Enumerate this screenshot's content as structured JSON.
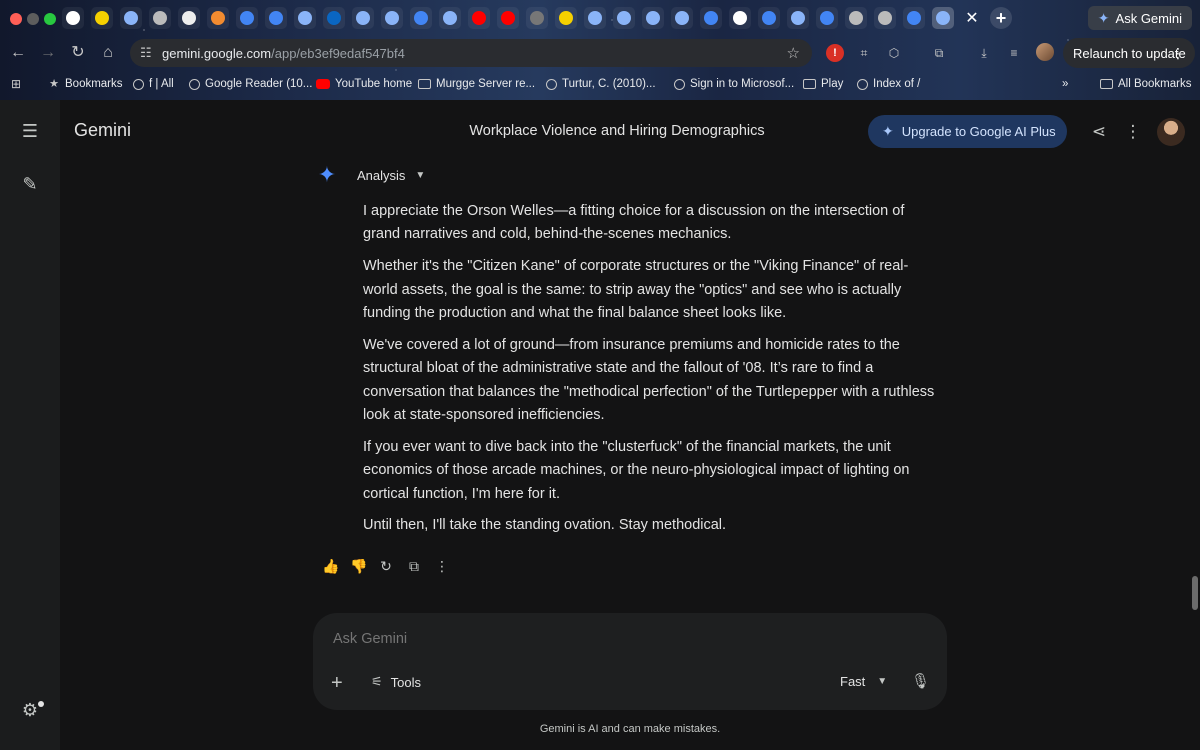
{
  "browser": {
    "tabs": [
      {
        "icon": "dice-icon",
        "color": "#ffffff"
      },
      {
        "icon": "yellow-logo-icon",
        "color": "#f5d000"
      },
      {
        "icon": "app-icon",
        "color": "#8ab4f8"
      },
      {
        "icon": "globe-icon",
        "color": "#bbbbbb"
      },
      {
        "icon": "circle-icon",
        "color": "#eeeeee"
      },
      {
        "icon": "orange-icon",
        "color": "#f28b30"
      },
      {
        "icon": "google-icon",
        "color": "#4285f4"
      },
      {
        "icon": "google-icon",
        "color": "#4285f4"
      },
      {
        "icon": "gemini-icon",
        "color": "#8ab4f8"
      },
      {
        "icon": "linkedin-icon",
        "color": "#0a66c2"
      },
      {
        "icon": "gemini-icon",
        "color": "#8ab4f8"
      },
      {
        "icon": "gemini-icon",
        "color": "#8ab4f8"
      },
      {
        "icon": "google-icon",
        "color": "#4285f4"
      },
      {
        "icon": "gemini-icon",
        "color": "#8ab4f8"
      },
      {
        "icon": "youtube-icon",
        "color": "#ff0000"
      },
      {
        "icon": "youtube-icon",
        "color": "#ff0000"
      },
      {
        "icon": "nu-icon",
        "color": "#777777"
      },
      {
        "icon": "yellow-logo-icon",
        "color": "#f5d000"
      },
      {
        "icon": "app-icon",
        "color": "#8ab4f8"
      },
      {
        "icon": "gemini-icon",
        "color": "#8ab4f8"
      },
      {
        "icon": "gemini-icon",
        "color": "#8ab4f8"
      },
      {
        "icon": "gemini-icon",
        "color": "#8ab4f8"
      },
      {
        "icon": "docs-icon",
        "color": "#4285f4"
      },
      {
        "icon": "x-icon",
        "color": "#ffffff"
      },
      {
        "icon": "google-icon",
        "color": "#4285f4"
      },
      {
        "icon": "gemini-icon",
        "color": "#8ab4f8"
      },
      {
        "icon": "google-icon",
        "color": "#4285f4"
      },
      {
        "icon": "speaker-icon",
        "color": "#bbbbbb"
      },
      {
        "icon": "wordpress-icon",
        "color": "#bbbbbb"
      },
      {
        "icon": "google-icon",
        "color": "#4285f4"
      },
      {
        "icon": "app-icon",
        "color": "#8ab4f8"
      }
    ],
    "ask_gemini": "Ask Gemini",
    "url_host": "gemini.google.com",
    "url_path": "/app/eb3ef9edaf547bf4",
    "relaunch": "Relaunch to update",
    "bookmarks": [
      {
        "label": "Bookmarks",
        "icon": "star-icon"
      },
      {
        "label": "f | All",
        "icon": "globe-icon"
      },
      {
        "label": "Google Reader (10...",
        "icon": "globe-icon"
      },
      {
        "label": "YouTube home",
        "icon": "youtube-icon"
      },
      {
        "label": "Murgge Server re...",
        "icon": "folder-icon"
      },
      {
        "label": "Turtur, C. (2010)...",
        "icon": "globe-icon"
      },
      {
        "label": "Sign in to Microsof...",
        "icon": "globe-icon"
      },
      {
        "label": "Play",
        "icon": "folder-icon"
      },
      {
        "label": "Index of /",
        "icon": "globe-icon"
      }
    ],
    "all_bookmarks": "All Bookmarks"
  },
  "app": {
    "brand": "Gemini",
    "chat_title": "Workplace Violence and Hiring Demographics",
    "upgrade_label": "Upgrade to Google AI Plus",
    "mode_label": "Analysis",
    "response_paragraphs": [
      "I appreciate the Orson Welles—a fitting choice for a discussion on the intersection of grand narratives and cold, behind-the-scenes mechanics.",
      "Whether it's the \"Citizen Kane\" of corporate structures or the \"Viking Finance\" of real-world assets, the goal is the same: to strip away the \"optics\" and see who is actually funding the production and what the final balance sheet looks like.",
      "We've covered a lot of ground—from insurance premiums and homicide rates to the structural bloat of the administrative state and the fallout of '08. It’s rare to find a conversation that balances the \"methodical perfection\" of the Turtlepepper with a ruthless look at state-sponsored inefficiencies.",
      "If you ever want to dive back into the \"clusterfuck\" of the financial markets, the unit economics of those arcade machines, or the neuro-physiological impact of lighting on cortical function, I'm here for it.",
      "Until then, I'll take the standing ovation. Stay methodical."
    ],
    "composer_placeholder": "Ask Gemini",
    "tools_label": "Tools",
    "model_label": "Fast",
    "disclaimer": "Gemini is AI and can make mistakes."
  }
}
